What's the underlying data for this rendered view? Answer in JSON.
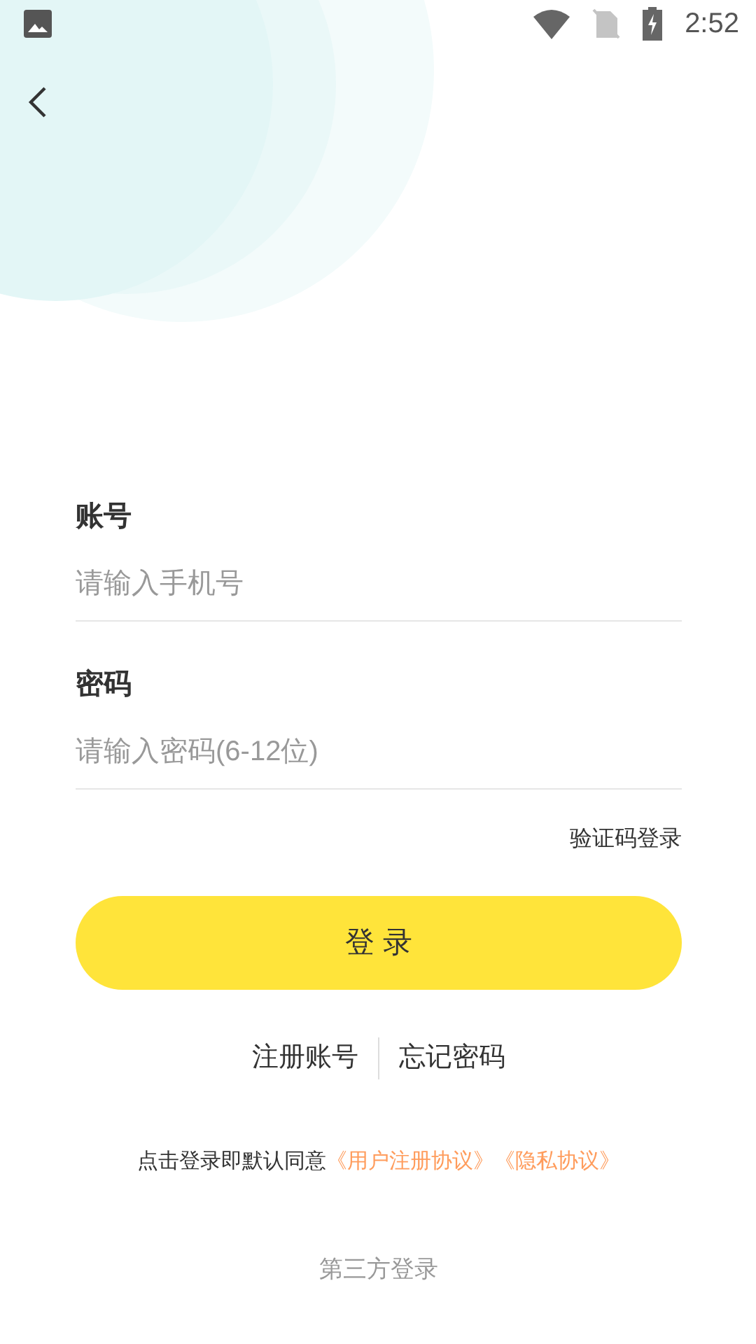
{
  "status_bar": {
    "time": "2:52"
  },
  "fields": [
    {
      "label": "账号",
      "placeholder": "请输入手机号"
    },
    {
      "label": "密码",
      "placeholder": "请输入密码(6-12位)"
    }
  ],
  "code_login_link": "验证码登录",
  "login_button": "登 录",
  "links": [
    "注册账号",
    "忘记密码"
  ],
  "agreement": {
    "text": "点击登录即默认同意",
    "links": [
      "《用户注册协议》",
      "《隐私协议》"
    ]
  },
  "third_party_label": "第三方登录"
}
